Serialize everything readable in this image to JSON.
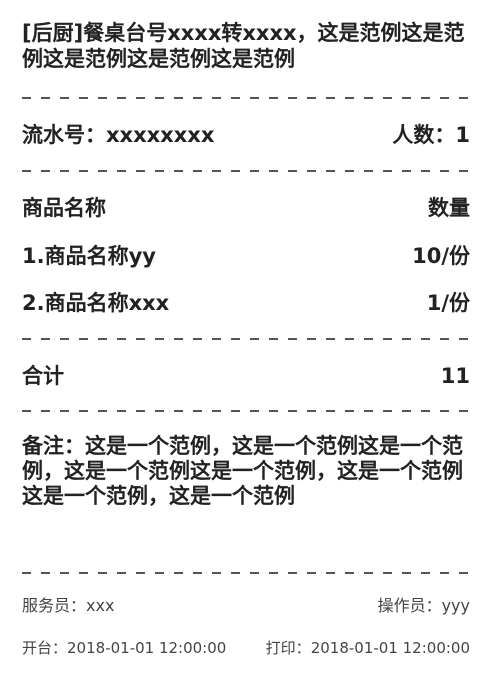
{
  "title": "[后厨]餐桌台号xxxx转xxxx，这是范例这是范例这是范例这是范例这是范例",
  "order": {
    "serial_label": "流水号：",
    "serial_value": "xxxxxxxx",
    "people_label": "人数：",
    "people_value": "1"
  },
  "items_header": {
    "name": "商品名称",
    "qty": "数量"
  },
  "items": [
    {
      "name": "1.商品名称yy",
      "qty": "10/份"
    },
    {
      "name": "2.商品名称xxx",
      "qty": "1/份"
    }
  ],
  "total": {
    "label": "合计",
    "value": "11"
  },
  "remark": "备注：这是一个范例，这是一个范例这是一个范例，这是一个范例这是一个范例，这是一个范例这是一个范例，这是一个范例",
  "staff": {
    "waiter": "服务员：xxx",
    "operator": "操作员：yyy"
  },
  "times": {
    "open_label": "开台：",
    "open_value": "2018-01-01 12:00:00",
    "print_label": "打印：",
    "print_value": "2018-01-01 12:00:00"
  }
}
